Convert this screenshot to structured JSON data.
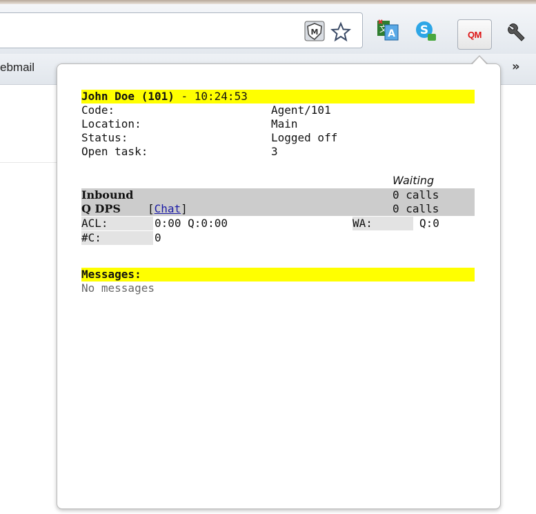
{
  "browser": {
    "bookmark_text": "ebmail",
    "overflow": "»",
    "extension_label": "QM"
  },
  "popup": {
    "agent_name": "John Doe (101)",
    "separator": " - ",
    "time": "10:24:53",
    "fields": [
      {
        "label": "Code:",
        "value": "Agent/101"
      },
      {
        "label": "Location:",
        "value": "Main"
      },
      {
        "label": "Status:",
        "value": "Logged off"
      },
      {
        "label": "Open task:",
        "value": "3"
      }
    ],
    "waiting_header": "Waiting",
    "inbound_label": "Inbound",
    "inbound_value": "0 calls",
    "queue_label": "Q DPS",
    "chat_open": "[",
    "chat_link": "Chat",
    "chat_close": "]",
    "queue_value": "0 calls",
    "acl_label": "ACL:",
    "acl_value": "0:00 Q:0:00",
    "wa_label": "WA:",
    "wa_value": "Q:0",
    "count_label": "#C:",
    "count_value": "0",
    "messages_title": "Messages:",
    "messages_empty": "No messages"
  },
  "colors": {
    "highlight": "#ffff00",
    "section_bg": "#cccccc",
    "link": "#1a1aa6"
  }
}
